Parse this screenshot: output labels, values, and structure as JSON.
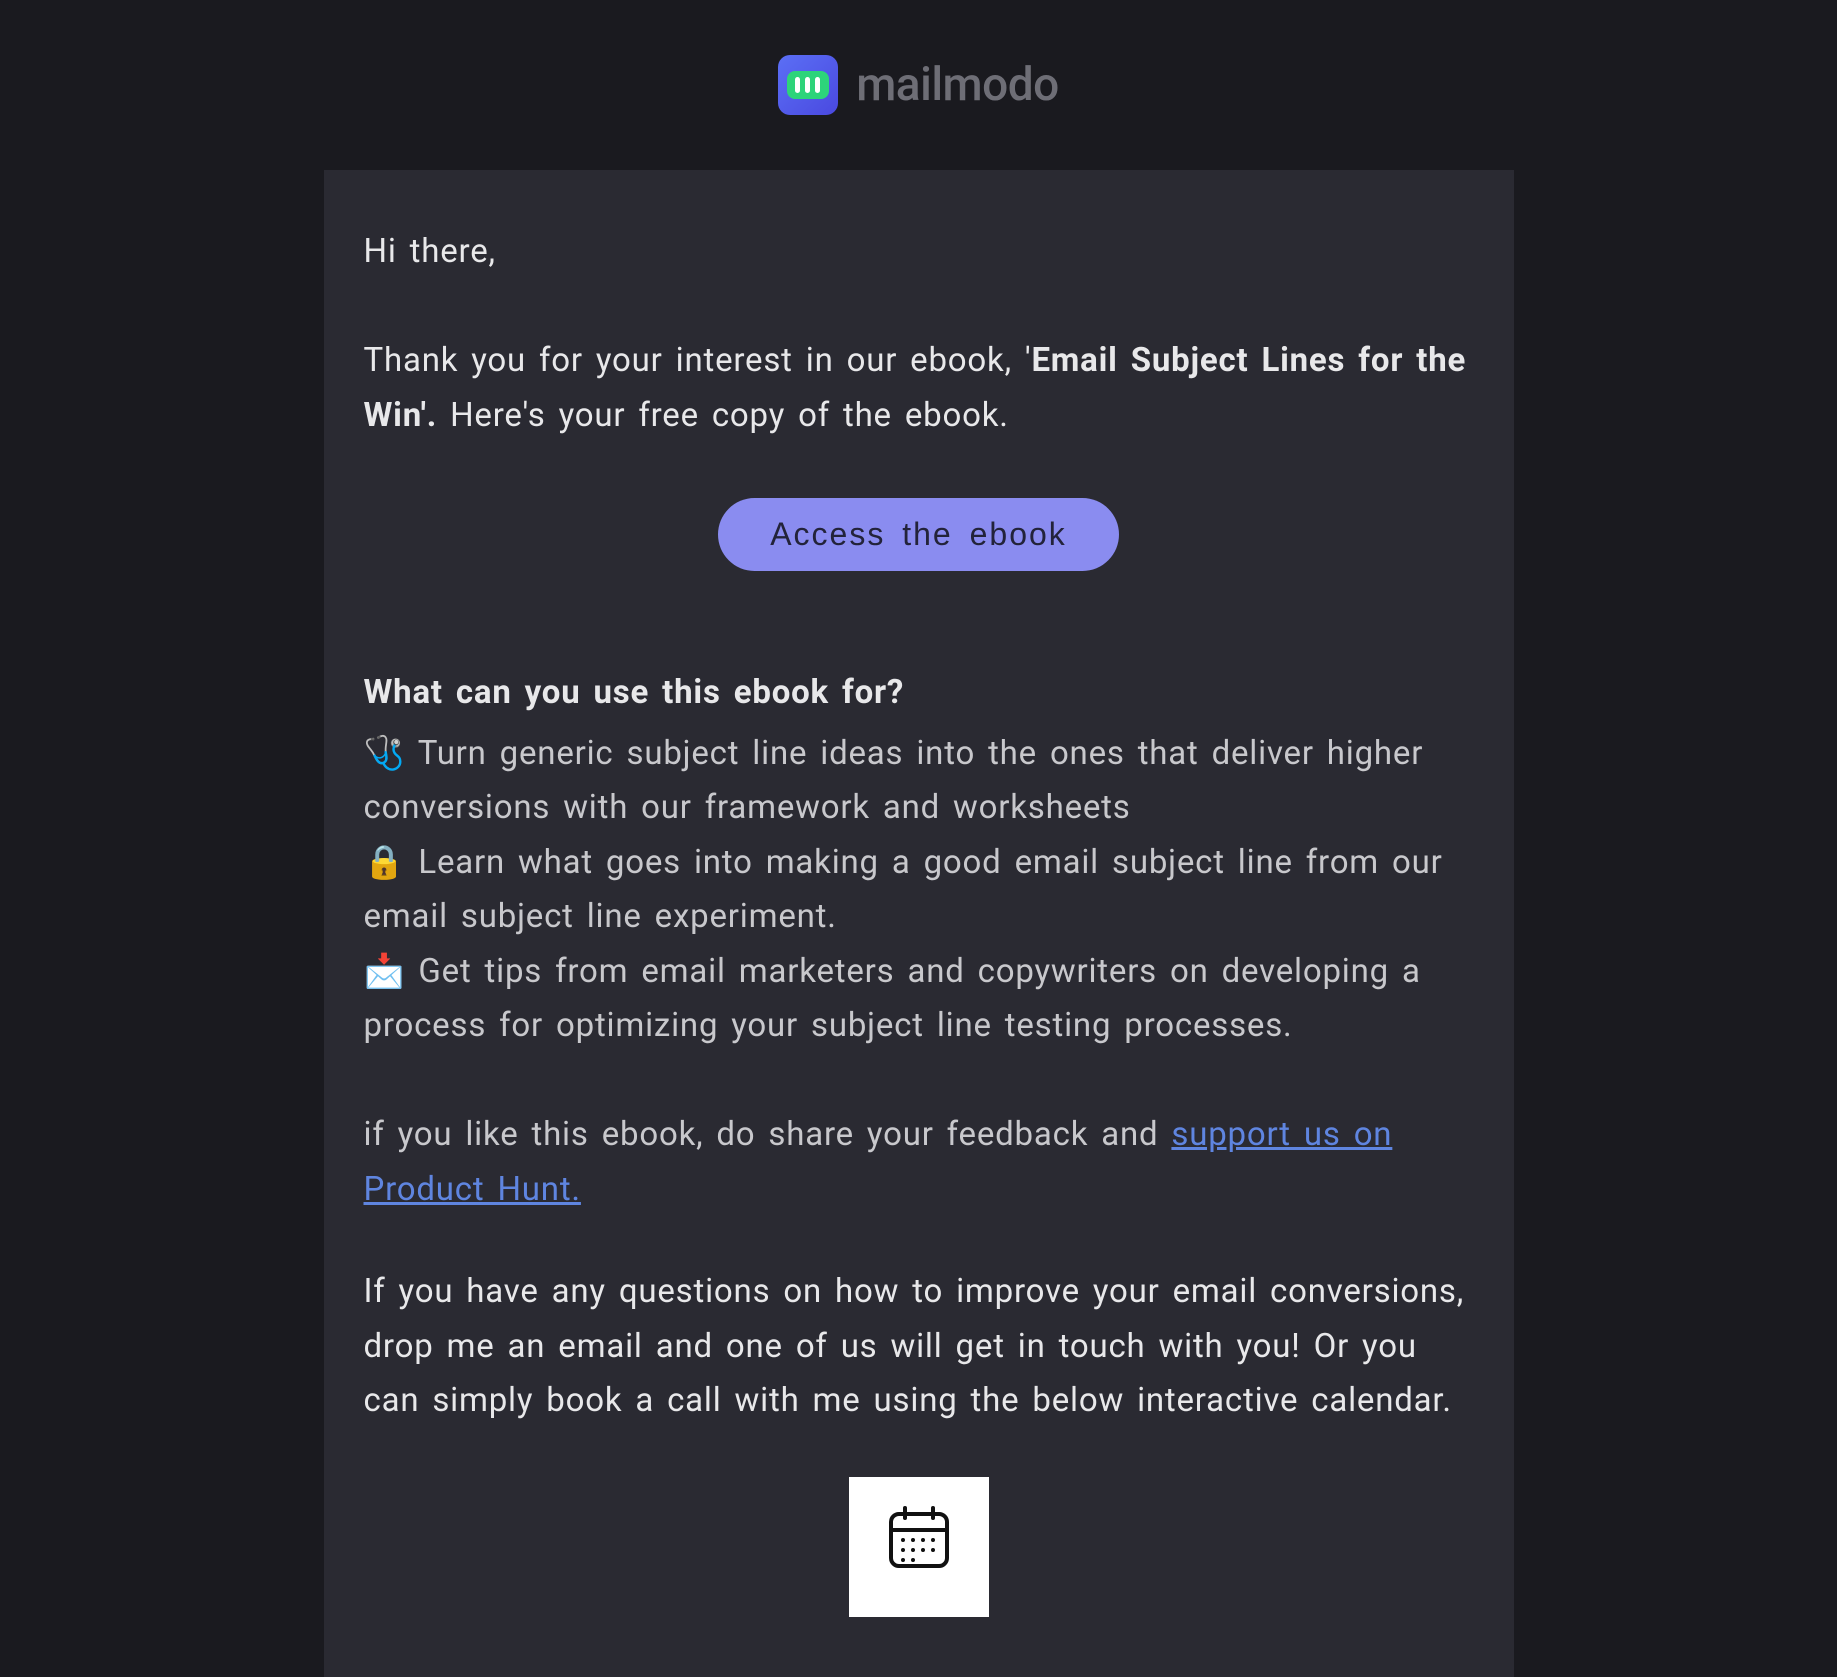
{
  "brand": {
    "name": "mailmodo"
  },
  "greeting": "Hi there,",
  "intro": {
    "prefix": "Thank you for your interest in our ebook, '",
    "bold": "Email Subject Lines for the Win'.",
    "suffix": " Here's your free copy of the ebook."
  },
  "cta_label": "Access the ebook",
  "section_title": "What can you use this ebook for?",
  "bullets": {
    "b1": "🩺 Turn generic subject line ideas into the ones that deliver higher conversions with our framework and worksheets",
    "b2": "🔒 Learn what goes into making a good email subject line from our email subject line experiment.",
    "b3": "📩 Get tips from email marketers and copywriters on developing a process for optimizing your subject line testing processes."
  },
  "feedback": {
    "prefix": "if you like this ebook, do share your feedback and ",
    "link": "support us on Product Hunt. "
  },
  "closing": "If you have any questions on how to improve your email conversions, drop me an email and one of us will get in touch with you! Or you can simply book a call with me using the below interactive calendar."
}
